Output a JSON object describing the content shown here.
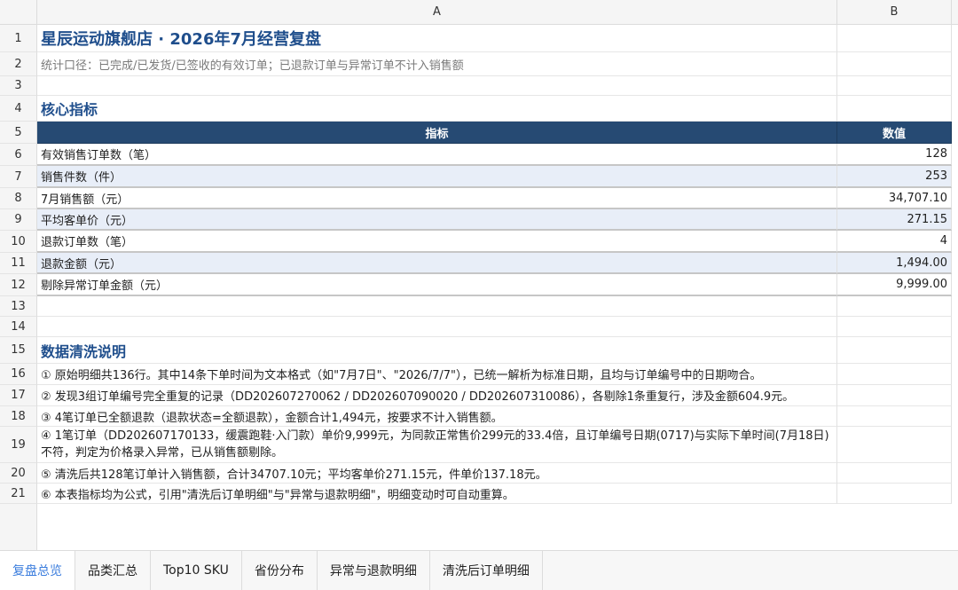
{
  "columns": [
    "A",
    "B"
  ],
  "rows": [
    {
      "num": "1",
      "a": "星辰运动旗舰店 · 2026年7月经营复盘",
      "b": ""
    },
    {
      "num": "2",
      "a": "统计口径：已完成/已发货/已签收的有效订单；已退款订单与异常订单不计入销售额",
      "b": ""
    },
    {
      "num": "3",
      "a": "",
      "b": ""
    },
    {
      "num": "4",
      "a": "核心指标",
      "b": ""
    },
    {
      "num": "5",
      "a": "指标",
      "b": "数值"
    },
    {
      "num": "6",
      "a": "有效销售订单数（笔）",
      "b": "128"
    },
    {
      "num": "7",
      "a": "销售件数（件）",
      "b": "253"
    },
    {
      "num": "8",
      "a": "7月销售额（元）",
      "b": "34,707.10"
    },
    {
      "num": "9",
      "a": "平均客单价（元）",
      "b": "271.15"
    },
    {
      "num": "10",
      "a": "退款订单数（笔）",
      "b": "4"
    },
    {
      "num": "11",
      "a": "退款金额（元）",
      "b": "1,494.00"
    },
    {
      "num": "12",
      "a": "剔除异常订单金额（元）",
      "b": "9,999.00"
    },
    {
      "num": "13",
      "a": "",
      "b": ""
    },
    {
      "num": "14",
      "a": "",
      "b": ""
    },
    {
      "num": "15",
      "a": "数据清洗说明",
      "b": ""
    },
    {
      "num": "16",
      "a": "① 原始明细共136行。其中14条下单时间为文本格式（如\"7月7日\"、\"2026/7/7\"），已统一解析为标准日期，且均与订单编号中的日期吻合。",
      "b": ""
    },
    {
      "num": "17",
      "a": "② 发现3组订单编号完全重复的记录（DD202607270062 / DD202607090020 / DD202607310086），各剔除1条重复行，涉及金额604.9元。",
      "b": ""
    },
    {
      "num": "18",
      "a": "③ 4笔订单已全额退款（退款状态=全额退款），金额合计1,494元，按要求不计入销售额。",
      "b": ""
    },
    {
      "num": "19",
      "a": "④ 1笔订单（DD202607170133，缓震跑鞋·入门款）单价9,999元，为同款正常售价299元的33.4倍，且订单编号日期(0717)与实际下单时间(7月18日)不符，判定为价格录入异常，已从销售额剔除。",
      "b": ""
    },
    {
      "num": "20",
      "a": "⑤ 清洗后共128笔订单计入销售额，合计34707.10元；平均客单价271.15元，件单价137.18元。",
      "b": ""
    },
    {
      "num": "21",
      "a": "⑥ 本表指标均为公式，引用\"清洗后订单明细\"与\"异常与退款明细\"，明细变动时可自动重算。",
      "b": ""
    }
  ],
  "tabs": [
    {
      "label": "复盘总览"
    },
    {
      "label": "品类汇总"
    },
    {
      "label": "Top10 SKU"
    },
    {
      "label": "省份分布"
    },
    {
      "label": "异常与退款明细"
    },
    {
      "label": "清洗后订单明细"
    }
  ],
  "active_tab": "复盘总览",
  "colors": {
    "title": "#1f4e8c",
    "header_bg": "#264a73",
    "zebra": "#e8eef8",
    "active_tab": "#3b7ddd"
  }
}
